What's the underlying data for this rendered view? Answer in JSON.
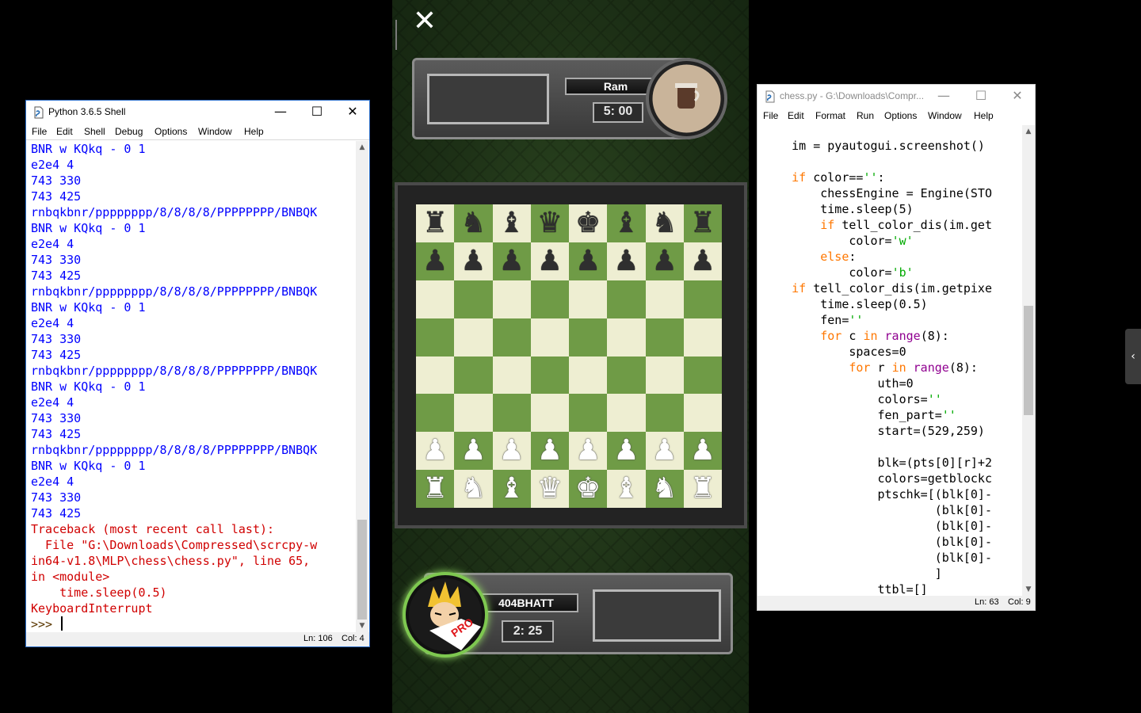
{
  "shell": {
    "title": "Python 3.6.5 Shell",
    "menu": [
      "File",
      "Edit",
      "Shell",
      "Debug",
      "Options",
      "Window",
      "Help"
    ],
    "lines": [
      {
        "t": "BNR w KQkq - 0 1",
        "c": "out"
      },
      {
        "t": "e2e4 4",
        "c": "out"
      },
      {
        "t": "743 330",
        "c": "out"
      },
      {
        "t": "743 425",
        "c": "out"
      },
      {
        "t": "rnbqkbnr/pppppppp/8/8/8/8/PPPPPPPP/BNBQK",
        "c": "out"
      },
      {
        "t": "BNR w KQkq - 0 1",
        "c": "out"
      },
      {
        "t": "e2e4 4",
        "c": "out"
      },
      {
        "t": "743 330",
        "c": "out"
      },
      {
        "t": "743 425",
        "c": "out"
      },
      {
        "t": "rnbqkbnr/pppppppp/8/8/8/8/PPPPPPPP/BNBQK",
        "c": "out"
      },
      {
        "t": "BNR w KQkq - 0 1",
        "c": "out"
      },
      {
        "t": "e2e4 4",
        "c": "out"
      },
      {
        "t": "743 330",
        "c": "out"
      },
      {
        "t": "743 425",
        "c": "out"
      },
      {
        "t": "rnbqkbnr/pppppppp/8/8/8/8/PPPPPPPP/BNBQK",
        "c": "out"
      },
      {
        "t": "BNR w KQkq - 0 1",
        "c": "out"
      },
      {
        "t": "e2e4 4",
        "c": "out"
      },
      {
        "t": "743 330",
        "c": "out"
      },
      {
        "t": "743 425",
        "c": "out"
      },
      {
        "t": "rnbqkbnr/pppppppp/8/8/8/8/PPPPPPPP/BNBQK",
        "c": "out"
      },
      {
        "t": "BNR w KQkq - 0 1",
        "c": "out"
      },
      {
        "t": "e2e4 4",
        "c": "out"
      },
      {
        "t": "743 330",
        "c": "out"
      },
      {
        "t": "743 425",
        "c": "out"
      },
      {
        "t": "Traceback (most recent call last):",
        "c": "err"
      },
      {
        "t": "  File \"G:\\Downloads\\Compressed\\scrcpy-w",
        "c": "err"
      },
      {
        "t": "in64-v1.8\\MLP\\chess\\chess.py\", line 65,",
        "c": "err"
      },
      {
        "t": "in <module>",
        "c": "err"
      },
      {
        "t": "    time.sleep(0.5)",
        "c": "err"
      },
      {
        "t": "KeyboardInterrupt",
        "c": "err"
      }
    ],
    "prompt": ">>> ",
    "status_ln": "Ln: 106",
    "status_col": "Col: 4"
  },
  "editor": {
    "title": "chess.py - G:\\Downloads\\Compr...",
    "menu": [
      "File",
      "Edit",
      "Format",
      "Run",
      "Options",
      "Window",
      "Help"
    ],
    "code": [
      [
        [
          "    im = pyautogui.screenshot()",
          ""
        ]
      ],
      [
        [
          "",
          ""
        ]
      ],
      [
        [
          "    ",
          ""
        ],
        [
          "if",
          "kw"
        ],
        [
          " color==",
          ""
        ],
        [
          "''",
          "st"
        ],
        [
          ":",
          ""
        ]
      ],
      [
        [
          "        chessEngine = Engine(STO",
          ""
        ]
      ],
      [
        [
          "        time.sleep(5)",
          ""
        ]
      ],
      [
        [
          "        ",
          ""
        ],
        [
          "if",
          "kw"
        ],
        [
          " tell_color_dis(im.get",
          ""
        ]
      ],
      [
        [
          "            color=",
          ""
        ],
        [
          "'w'",
          "st"
        ]
      ],
      [
        [
          "        ",
          ""
        ],
        [
          "else",
          "kw"
        ],
        [
          ":",
          ""
        ]
      ],
      [
        [
          "            color=",
          ""
        ],
        [
          "'b'",
          "st"
        ]
      ],
      [
        [
          "    ",
          ""
        ],
        [
          "if",
          "kw"
        ],
        [
          " tell_color_dis(im.getpixe",
          ""
        ]
      ],
      [
        [
          "        time.sleep(0.5)",
          ""
        ]
      ],
      [
        [
          "        fen=",
          ""
        ],
        [
          "''",
          "st"
        ]
      ],
      [
        [
          "        ",
          ""
        ],
        [
          "for",
          "kw"
        ],
        [
          " c ",
          ""
        ],
        [
          "in",
          "kw"
        ],
        [
          " ",
          ""
        ],
        [
          "range",
          "bi"
        ],
        [
          "(8):",
          ""
        ]
      ],
      [
        [
          "            spaces=0",
          ""
        ]
      ],
      [
        [
          "            ",
          ""
        ],
        [
          "for",
          "kw"
        ],
        [
          " r ",
          ""
        ],
        [
          "in",
          "kw"
        ],
        [
          " ",
          ""
        ],
        [
          "range",
          "bi"
        ],
        [
          "(8):",
          ""
        ]
      ],
      [
        [
          "                uth=0",
          ""
        ]
      ],
      [
        [
          "                colors=",
          ""
        ],
        [
          "''",
          "st"
        ]
      ],
      [
        [
          "                fen_part=",
          ""
        ],
        [
          "''",
          "st"
        ]
      ],
      [
        [
          "                start=(529,259)",
          ""
        ]
      ],
      [
        [
          "",
          ""
        ]
      ],
      [
        [
          "                blk=(pts[0][r]+2",
          ""
        ]
      ],
      [
        [
          "                colors=getblockc",
          ""
        ]
      ],
      [
        [
          "                ptschk=[(blk[0]-",
          ""
        ]
      ],
      [
        [
          "                        (blk[0]-",
          ""
        ]
      ],
      [
        [
          "                        (blk[0]-",
          ""
        ]
      ],
      [
        [
          "                        (blk[0]-",
          ""
        ]
      ],
      [
        [
          "                        (blk[0]-",
          ""
        ]
      ],
      [
        [
          "                        ]",
          ""
        ]
      ],
      [
        [
          "                ttbl=[]",
          ""
        ]
      ]
    ],
    "status_ln": "Ln: 63",
    "status_col": "Col: 9"
  },
  "game": {
    "close_glyph": "✕",
    "opponent": {
      "name": "Ram",
      "time": "5: 00"
    },
    "player": {
      "name": "404BHATT",
      "time": "2: 25",
      "badge": "PRO"
    },
    "board": [
      [
        "r",
        "n",
        "b",
        "q",
        "k",
        "b",
        "n",
        "r"
      ],
      [
        "p",
        "p",
        "p",
        "p",
        "p",
        "p",
        "p",
        "p"
      ],
      [
        "",
        "",
        "",
        "",
        "",
        "",
        "",
        ""
      ],
      [
        "",
        "",
        "",
        "",
        "",
        "",
        "",
        ""
      ],
      [
        "",
        "",
        "",
        "",
        "",
        "",
        "",
        ""
      ],
      [
        "",
        "",
        "",
        "",
        "",
        "",
        "",
        ""
      ],
      [
        "P",
        "P",
        "P",
        "P",
        "P",
        "P",
        "P",
        "P"
      ],
      [
        "R",
        "N",
        "B",
        "Q",
        "K",
        "B",
        "N",
        "R"
      ]
    ]
  },
  "side_tab_glyph": "‹",
  "icons": {
    "close": "close-icon",
    "minimize": "minimize-icon",
    "maximize": "maximize-icon",
    "python": "python-file-icon"
  }
}
